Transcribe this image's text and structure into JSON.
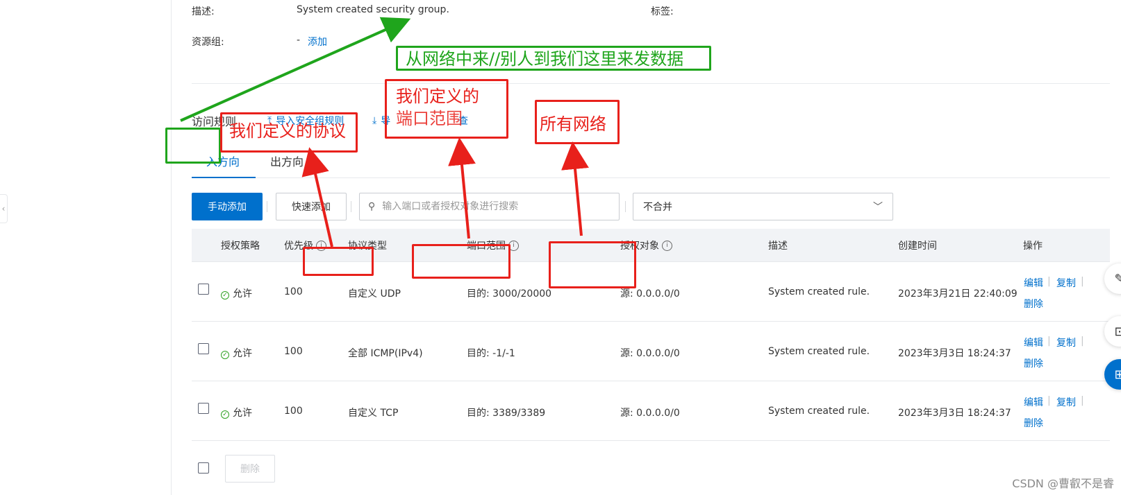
{
  "info": {
    "desc_label": "描述:",
    "desc_value": "System created security group.",
    "tags_label": "标签:",
    "rg_label": "资源组:",
    "rg_value": "-",
    "rg_add": "添加"
  },
  "rules": {
    "title": "访问规则",
    "import_label": "导入安全组规则",
    "export_label": "导",
    "check_label": "查"
  },
  "tabs": [
    {
      "label": "入方向",
      "active": true
    },
    {
      "label": "出方向",
      "active": false
    }
  ],
  "toolbar": {
    "manual_add": "手动添加",
    "quick_add": "快速添加",
    "search_placeholder": "输入端口或者授权对象进行搜索",
    "merge_select": "不合并"
  },
  "table": {
    "headers": [
      "授权策略",
      "优先级",
      "协议类型",
      "端口范围",
      "授权对象",
      "描述",
      "创建时间",
      "操作"
    ],
    "rows": [
      {
        "policy": "允许",
        "priority": "100",
        "protocol": "自定义 UDP",
        "port": "目的: 3000/20000",
        "source": "源: 0.0.0.0/0",
        "desc": "System created rule.",
        "created": "2023年3月21日 22:40:09",
        "edit": "编辑",
        "copy": "复制",
        "delete": "删除"
      },
      {
        "policy": "允许",
        "priority": "100",
        "protocol": "全部 ICMP(IPv4)",
        "port": "目的: -1/-1",
        "source": "源: 0.0.0.0/0",
        "desc": "System created rule.",
        "created": "2023年3月3日 18:24:37",
        "edit": "编辑",
        "copy": "复制",
        "delete": "删除"
      },
      {
        "policy": "允许",
        "priority": "100",
        "protocol": "自定义 TCP",
        "port": "目的: 3389/3389",
        "source": "源: 0.0.0.0/0",
        "desc": "System created rule.",
        "created": "2023年3月3日 18:24:37",
        "edit": "编辑",
        "copy": "复制",
        "delete": "删除"
      }
    ],
    "bulk_delete": "删除"
  },
  "annotations": {
    "green_text": "从网络中来//别人到我们这里来发数据",
    "protocol_text": "我们定义的协议",
    "port_text_line1": "我们定义的",
    "port_text_line2": "端口范围",
    "network_text": "所有网络",
    "red": "#e8201b",
    "green": "#1fa51c"
  },
  "watermark": "CSDN @曹叡不是睿",
  "colors": {
    "primary": "#0070cc",
    "allow": "#2ea121"
  }
}
